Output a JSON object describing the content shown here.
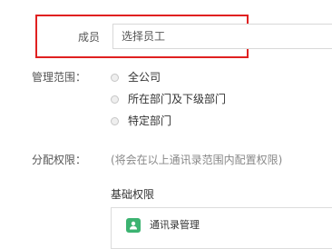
{
  "member": {
    "label": "成员",
    "input_value": "选择员工"
  },
  "scope": {
    "label": "管理范围：",
    "options": [
      {
        "label": "全公司"
      },
      {
        "label": "所在部门及下级部门"
      },
      {
        "label": "特定部门"
      }
    ]
  },
  "permissions": {
    "label": "分配权限：",
    "note": "(将会在以上通讯录范围内配置权限)",
    "basic_title": "基础权限",
    "items": [
      {
        "label": "通讯录管理",
        "icon": "contacts-icon",
        "icon_color": "#3cb371"
      }
    ]
  },
  "colors": {
    "highlight_border": "#e02020",
    "accent": "#3cb371"
  }
}
